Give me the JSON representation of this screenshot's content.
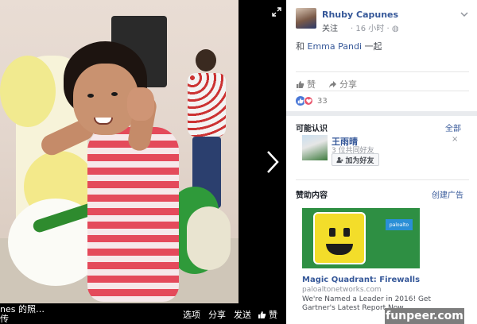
{
  "photo": {
    "caption_line1": "nes 的照…",
    "caption_line2": "传",
    "actions": [
      "选项",
      "分享",
      "发送"
    ],
    "like_label": "赞"
  },
  "post": {
    "author": "Rhuby Capunes",
    "follow_label": "关注",
    "time": "16 小时",
    "tagline_prefix": "和 ",
    "tagline_name": "Emma Pandi",
    "tagline_suffix": " 一起",
    "like_label": "赞",
    "share_label": "分享",
    "reaction_count": "33"
  },
  "pymk": {
    "title": "可能认识",
    "all_label": "全部",
    "name": "王雨晴",
    "mutual": "3 位共同好友",
    "add_label": "加为好友",
    "close_label": "×"
  },
  "sponsored": {
    "title": "赞助内容",
    "create_label": "创建广告",
    "ad_logo": "paloalto",
    "ad_title": "Magic Quadrant: Firewalls",
    "ad_domain": "paloaltonetworks.com",
    "ad_desc": "We're Named a Leader in 2016! Get Gartner's Latest Report Now."
  },
  "watermark": "funpeer.com",
  "colors": {
    "link": "#365899",
    "like_reaction": "#4a78d6",
    "love_reaction": "#e9566c",
    "ad_bg": "#2e8f43"
  }
}
